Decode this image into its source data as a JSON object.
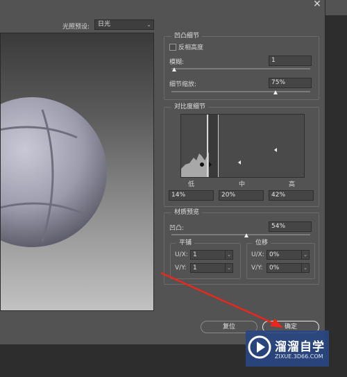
{
  "dialog": {
    "close_glyph": "✕",
    "preset_label": "光照预设:",
    "preset_value": "日光"
  },
  "bump_detail": {
    "title": "凹凸细节",
    "invert_label": "反相高度",
    "invert_checked": false,
    "blur_label": "模糊:",
    "blur_value": "1",
    "blur_level": 0.02,
    "scale_label": "细节缩放:",
    "scale_value": "75%",
    "scale_level": 0.75
  },
  "contrast_detail": {
    "title": "对比度细节",
    "low_label": "低",
    "mid_label": "中",
    "high_label": "高",
    "low_value": "14%",
    "mid_value": "20%",
    "high_value": "42%"
  },
  "material_preview": {
    "title": "材质预览",
    "bump_label": "凹凸:",
    "bump_value": "54%",
    "bump_level": 0.54,
    "tile_title": "平铺",
    "offset_title": "位移",
    "tile_ux_label": "U/X:",
    "tile_ux_value": "1",
    "tile_vy_label": "V/Y:",
    "tile_vy_value": "1",
    "offset_ux_label": "U/X:",
    "offset_ux_value": "0%",
    "offset_vy_label": "V/Y:",
    "offset_vy_value": "0%"
  },
  "buttons": {
    "reset": "复位",
    "ok": "确定"
  },
  "watermark": {
    "title": "溜溜自学",
    "url": "ZIXUE.3D66.COM"
  },
  "colors": {
    "panel": "#535353",
    "arrow": "#e8271d",
    "watermark_bg": "#284682"
  }
}
